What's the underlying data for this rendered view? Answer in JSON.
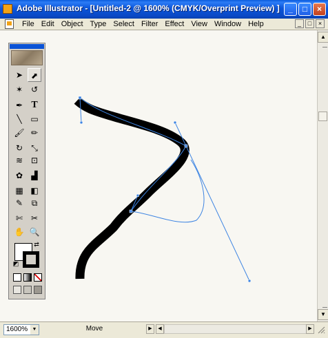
{
  "window": {
    "title": "Adobe Illustrator - [Untitled-2 @ 1600% (CMYK/Overprint Preview) ]",
    "controls": {
      "minimize": "_",
      "maximize": "□",
      "close": "×"
    }
  },
  "menu": {
    "items": [
      "File",
      "Edit",
      "Object",
      "Type",
      "Select",
      "Filter",
      "Effect",
      "View",
      "Window",
      "Help"
    ]
  },
  "status": {
    "zoom": "1600%",
    "tool_status": "Move"
  },
  "icons": {
    "selection": "➤",
    "direct": "⬈",
    "magic": "✶",
    "lasso": "↺",
    "pen": "✒",
    "type": "T",
    "line": "╲",
    "rect": "▭",
    "brush": "🖌",
    "pencil": "✏",
    "rotate": "↻",
    "scale": "⤡",
    "warp": "≋",
    "free": "⊡",
    "symbol": "✿",
    "graph": "▟",
    "mesh": "▦",
    "gradient": "◧",
    "eyedrop": "✎",
    "blend": "⧉",
    "slice": "✄",
    "scissors": "✂",
    "hand": "✋",
    "zoom": "🔍"
  },
  "colors": {
    "path_stroke": "#000000",
    "anchor_blue": "#3d84e2"
  }
}
